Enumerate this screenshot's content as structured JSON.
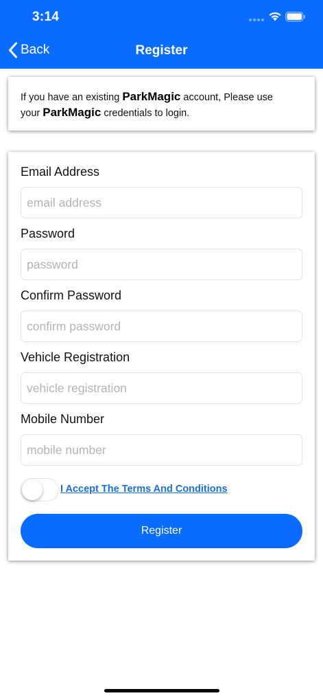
{
  "status_bar": {
    "time": "3:14",
    "icons": [
      "cellular-signal-icon",
      "wifi-icon",
      "battery-icon"
    ]
  },
  "nav": {
    "back_label": "Back",
    "title": "Register",
    "back_icon": "chevron-left-icon"
  },
  "info": {
    "line1_prefix": "If you have an existing ",
    "brand": "ParkMagic",
    "line1_suffix": " account, Please use",
    "line2_prefix": "your ",
    "line2_suffix": " credentials to login."
  },
  "form": {
    "email": {
      "label": "Email Address",
      "placeholder": "email address",
      "value": ""
    },
    "password": {
      "label": "Password",
      "placeholder": "password",
      "value": ""
    },
    "confirm_password": {
      "label": "Confirm Password",
      "placeholder": "confirm password",
      "value": ""
    },
    "vehicle_registration": {
      "label": "Vehicle Registration",
      "placeholder": "vehicle registration",
      "value": ""
    },
    "mobile_number": {
      "label": "Mobile Number",
      "placeholder": "mobile number",
      "value": ""
    },
    "terms": {
      "label": "I Accept The Terms And Conditions",
      "accepted": false
    },
    "submit_label": "Register"
  },
  "colors": {
    "primary": "#0a6cff",
    "link": "#1a6fd9",
    "placeholder": "#b4b4b4"
  }
}
